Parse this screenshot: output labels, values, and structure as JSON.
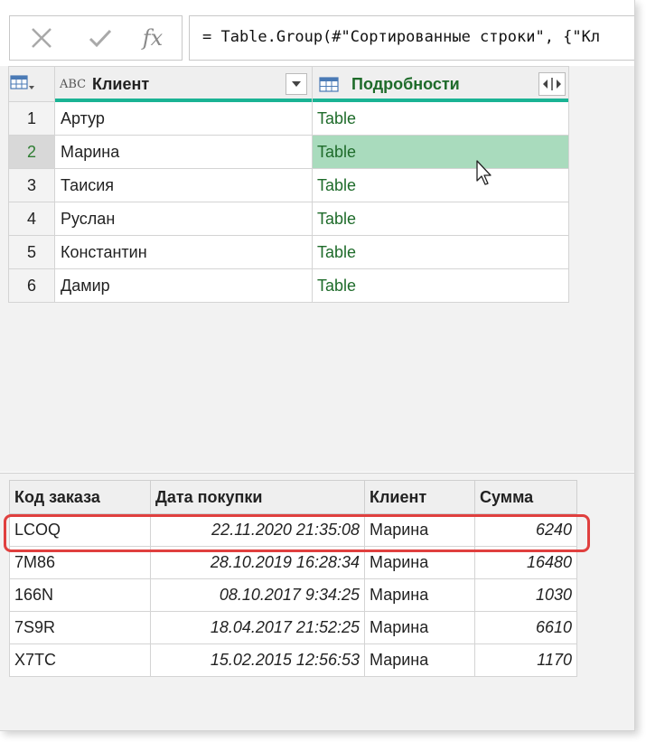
{
  "formula_bar": {
    "cancel_icon": "close-icon",
    "confirm_icon": "check-icon",
    "fx_label": "fx",
    "formula": "= Table.Group(#\"Сортированные строки\", {\"Кл"
  },
  "grid": {
    "columns": [
      {
        "type_icon": "abc-type-icon",
        "type_label": "ABC",
        "label": "Клиент"
      },
      {
        "type_icon": "table-type-icon",
        "label": "Подробности"
      }
    ],
    "rows": [
      {
        "num": "1",
        "client": "Артур",
        "details": "Table"
      },
      {
        "num": "2",
        "client": "Марина",
        "details": "Table"
      },
      {
        "num": "3",
        "client": "Таисия",
        "details": "Table"
      },
      {
        "num": "4",
        "client": "Руслан",
        "details": "Table"
      },
      {
        "num": "5",
        "client": "Константин",
        "details": "Table"
      },
      {
        "num": "6",
        "client": "Дамир",
        "details": "Table"
      }
    ],
    "selected_row": 2
  },
  "details_table": {
    "headers": [
      "Код заказа",
      "Дата покупки",
      "Клиент",
      "Сумма"
    ],
    "rows": [
      {
        "code": "LCOQ",
        "date": "22.11.2020 21:35:08",
        "client": "Марина",
        "sum": "6240"
      },
      {
        "code": "7M86",
        "date": "28.10.2019 16:28:34",
        "client": "Марина",
        "sum": "16480"
      },
      {
        "code": "166N",
        "date": "08.10.2017 9:34:25",
        "client": "Марина",
        "sum": "1030"
      },
      {
        "code": "7S9R",
        "date": "18.04.2017 21:52:25",
        "client": "Марина",
        "sum": "6610"
      },
      {
        "code": "X7TC",
        "date": "15.02.2015 12:56:53",
        "client": "Марина",
        "sum": "1170"
      }
    ]
  },
  "colors": {
    "accent": "#1ab394",
    "selection": "#a9dbbd",
    "highlight": "#e0403f",
    "table_text": "#1e6b2a"
  }
}
